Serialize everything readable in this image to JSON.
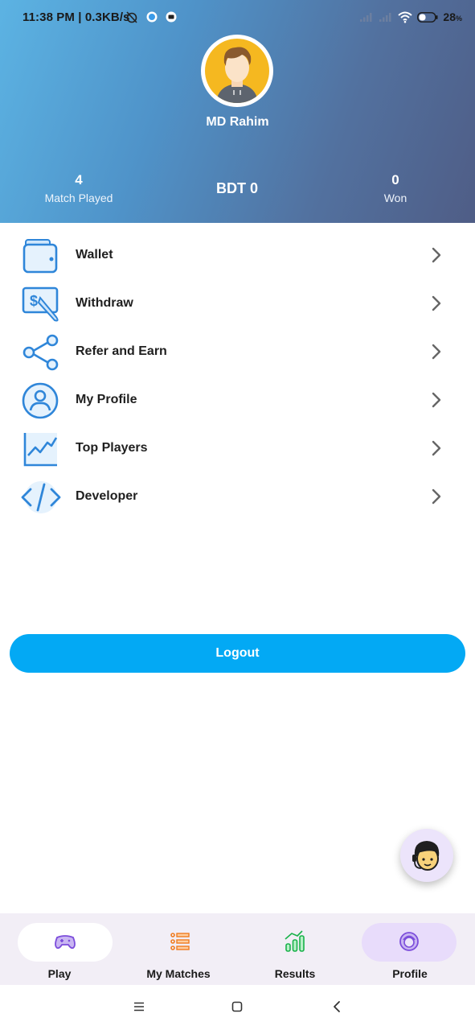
{
  "status_bar": {
    "time": "11:38 PM | 0.3KB/s",
    "battery": "28"
  },
  "profile": {
    "name": "MD Rahim",
    "matches_played": "4",
    "matches_played_label": "Match Played",
    "balance": "BDT 0",
    "won": "0",
    "won_label": "Won"
  },
  "menu": {
    "items": [
      {
        "label": "Wallet",
        "icon": "wallet-icon"
      },
      {
        "label": "Withdraw",
        "icon": "withdraw-icon"
      },
      {
        "label": "Refer and Earn",
        "icon": "share-icon"
      },
      {
        "label": "My Profile",
        "icon": "profile-icon"
      },
      {
        "label": "Top Players",
        "icon": "chart-icon"
      },
      {
        "label": "Developer",
        "icon": "code-icon"
      }
    ]
  },
  "logout_label": "Logout",
  "bottom_nav": {
    "items": [
      {
        "label": "Play",
        "icon": "gamepad-icon"
      },
      {
        "label": "My Matches",
        "icon": "list-icon"
      },
      {
        "label": "Results",
        "icon": "bar-chart-icon"
      },
      {
        "label": "Profile",
        "icon": "user-face-icon"
      }
    ]
  },
  "colors": {
    "accent": "#03a9f4",
    "menu_icon": "#2f86d9",
    "nav_active_pill": "#e8dcfb",
    "nav_background": "#f2eef6"
  }
}
